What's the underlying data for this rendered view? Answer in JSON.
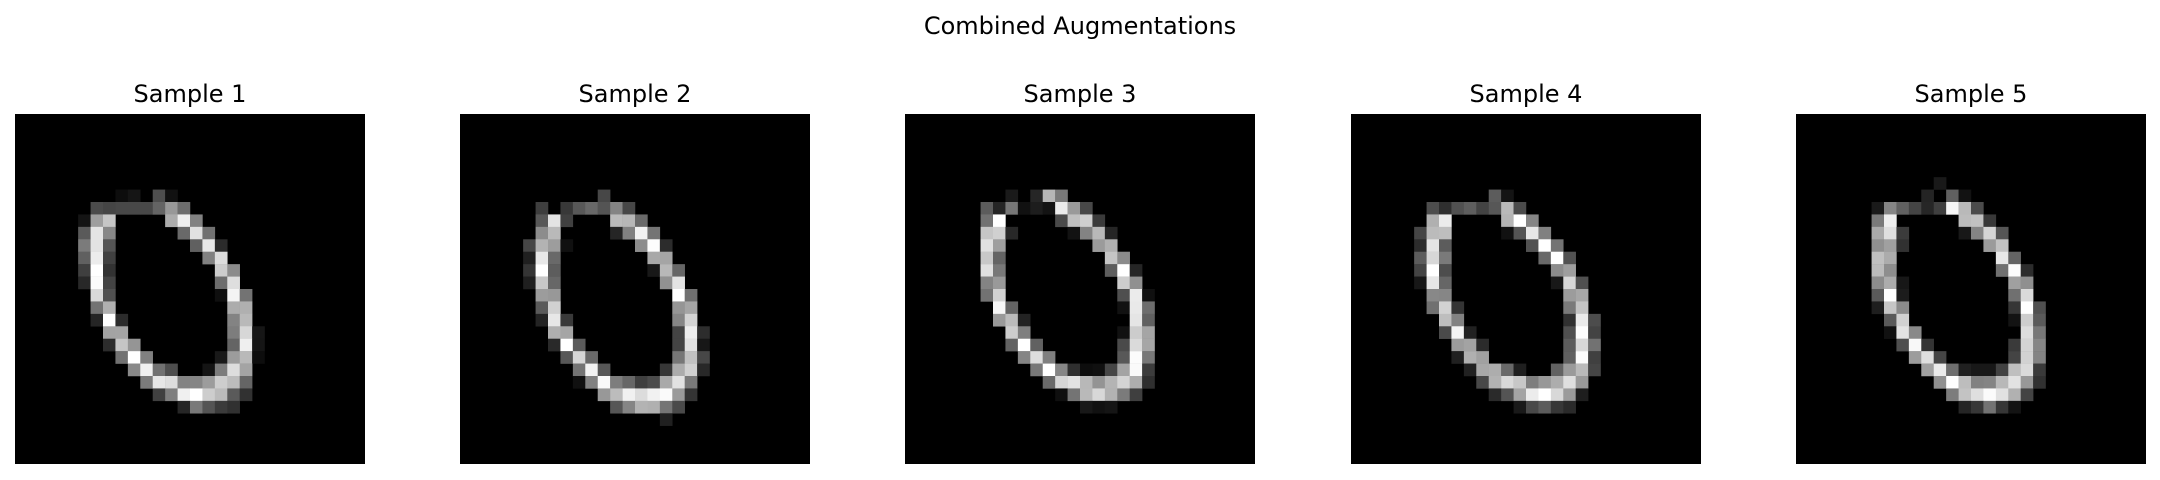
{
  "figure": {
    "title": "Combined Augmentations"
  },
  "panels": [
    {
      "title": "Sample 1",
      "image": "augmented-digit-zero"
    },
    {
      "title": "Sample 2",
      "image": "augmented-digit-zero"
    },
    {
      "title": "Sample 3",
      "image": "augmented-digit-zero"
    },
    {
      "title": "Sample 4",
      "image": "augmented-digit-zero"
    },
    {
      "title": "Sample 5",
      "image": "augmented-digit-zero"
    }
  ],
  "colors": {
    "background": "#ffffff",
    "image_background": "#000000",
    "stroke": "#ffffff"
  }
}
